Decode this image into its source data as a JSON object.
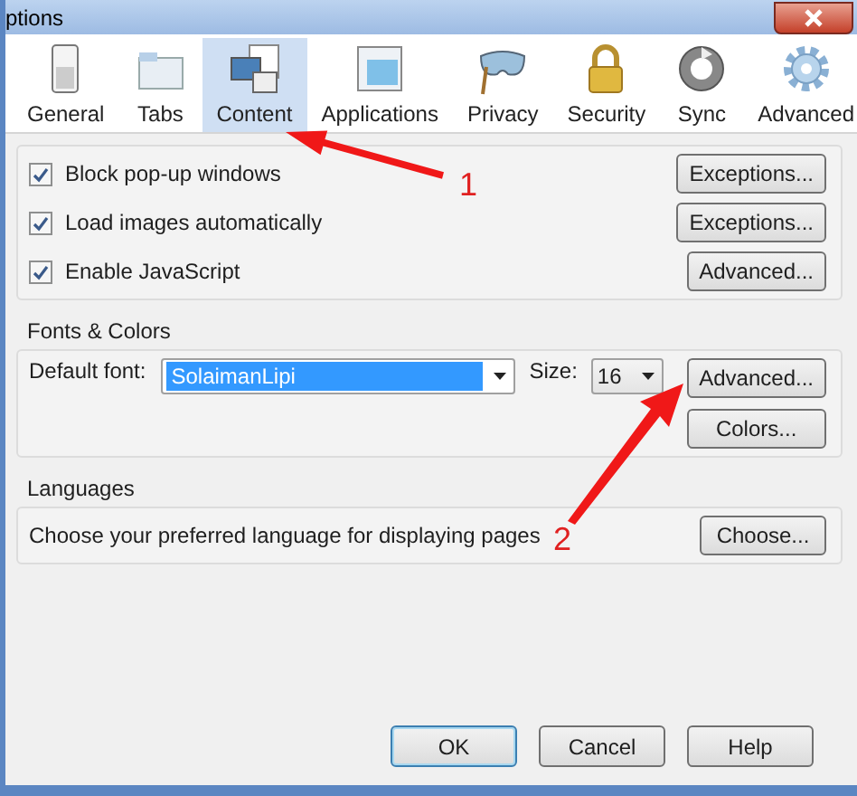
{
  "window": {
    "title": "ptions"
  },
  "toolbar": [
    {
      "label": "General",
      "selected": false
    },
    {
      "label": "Tabs",
      "selected": false
    },
    {
      "label": "Content",
      "selected": true
    },
    {
      "label": "Applications",
      "selected": false
    },
    {
      "label": "Privacy",
      "selected": false
    },
    {
      "label": "Security",
      "selected": false
    },
    {
      "label": "Sync",
      "selected": false
    },
    {
      "label": "Advanced",
      "selected": false
    }
  ],
  "content_options": [
    {
      "label": "Block pop-up windows",
      "checked": true,
      "button": "Exceptions..."
    },
    {
      "label": "Load images automatically",
      "checked": true,
      "button": "Exceptions..."
    },
    {
      "label": "Enable JavaScript",
      "checked": true,
      "button": "Advanced..."
    }
  ],
  "fonts_colors": {
    "title": "Fonts & Colors",
    "default_font_label": "Default font:",
    "default_font_value": "SolaimanLipi",
    "size_label": "Size:",
    "size_value": "16",
    "buttons": [
      "Advanced...",
      "Colors..."
    ]
  },
  "languages": {
    "title": "Languages",
    "text": "Choose your preferred language for displaying pages",
    "button": "Choose..."
  },
  "buttons": [
    {
      "label": "OK",
      "default": true
    },
    {
      "label": "Cancel",
      "default": false
    },
    {
      "label": "Help",
      "default": false
    }
  ],
  "annotations": [
    {
      "label": "1"
    },
    {
      "label": "2"
    }
  ]
}
